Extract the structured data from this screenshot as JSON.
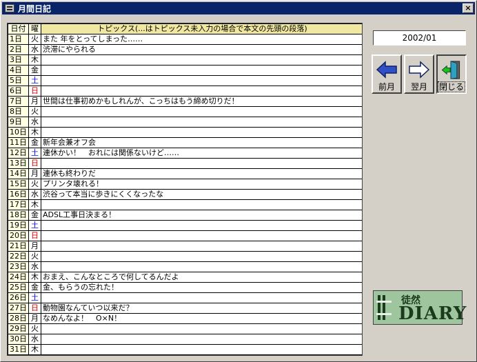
{
  "window": {
    "title": "月間日記",
    "close_glyph": "×"
  },
  "table": {
    "headers": {
      "day": "日付",
      "weekday": "曜",
      "topic": "トピックス(...はトピックス未入力の場合で本文の先頭の段落)"
    },
    "rows": [
      {
        "day": "1日",
        "wd": "火",
        "type": "weekday",
        "topic": "また 年をとってしまった……"
      },
      {
        "day": "2日",
        "wd": "水",
        "type": "weekday",
        "topic": "渋滞にやられる"
      },
      {
        "day": "3日",
        "wd": "木",
        "type": "weekday",
        "topic": ""
      },
      {
        "day": "4日",
        "wd": "金",
        "type": "weekday",
        "topic": ""
      },
      {
        "day": "5日",
        "wd": "土",
        "type": "sat",
        "topic": ""
      },
      {
        "day": "6日",
        "wd": "日",
        "type": "sun",
        "topic": ""
      },
      {
        "day": "7日",
        "wd": "月",
        "type": "weekday",
        "topic": "世間は仕事初めかもしれんが、こっちはもう締め切りだ！"
      },
      {
        "day": "8日",
        "wd": "火",
        "type": "weekday",
        "topic": ""
      },
      {
        "day": "9日",
        "wd": "水",
        "type": "weekday",
        "topic": ""
      },
      {
        "day": "10日",
        "wd": "木",
        "type": "weekday",
        "topic": ""
      },
      {
        "day": "11日",
        "wd": "金",
        "type": "weekday",
        "topic": "新年会兼オフ会"
      },
      {
        "day": "12日",
        "wd": "土",
        "type": "sat",
        "topic": "連休かい！　おれには関係ないけど……"
      },
      {
        "day": "13日",
        "wd": "日",
        "type": "sun",
        "topic": ""
      },
      {
        "day": "14日",
        "wd": "月",
        "type": "weekday",
        "topic": "連休も終わりだ"
      },
      {
        "day": "15日",
        "wd": "火",
        "type": "weekday",
        "topic": "プリンタ壊れる！"
      },
      {
        "day": "16日",
        "wd": "水",
        "type": "weekday",
        "topic": "渋谷って本当に歩きにくくなったな"
      },
      {
        "day": "17日",
        "wd": "木",
        "type": "weekday",
        "topic": ""
      },
      {
        "day": "18日",
        "wd": "金",
        "type": "weekday",
        "topic": "ADSL工事日決まる！"
      },
      {
        "day": "19日",
        "wd": "土",
        "type": "sat",
        "topic": ""
      },
      {
        "day": "20日",
        "wd": "日",
        "type": "sun",
        "topic": ""
      },
      {
        "day": "21日",
        "wd": "月",
        "type": "weekday",
        "topic": ""
      },
      {
        "day": "22日",
        "wd": "火",
        "type": "weekday",
        "topic": ""
      },
      {
        "day": "23日",
        "wd": "水",
        "type": "weekday",
        "topic": ""
      },
      {
        "day": "24日",
        "wd": "木",
        "type": "weekday",
        "topic": "おまえ、こんなところで何してるんだよ"
      },
      {
        "day": "25日",
        "wd": "金",
        "type": "weekday",
        "topic": "金、もらうの忘れた！"
      },
      {
        "day": "26日",
        "wd": "土",
        "type": "sat",
        "topic": ""
      },
      {
        "day": "27日",
        "wd": "日",
        "type": "sun",
        "topic": "動物園なんていつ以来だ？"
      },
      {
        "day": "28日",
        "wd": "月",
        "type": "weekday",
        "topic": "なめんなよ！　O×N！"
      },
      {
        "day": "29日",
        "wd": "火",
        "type": "weekday",
        "topic": ""
      },
      {
        "day": "30日",
        "wd": "水",
        "type": "weekday",
        "topic": ""
      },
      {
        "day": "31日",
        "wd": "木",
        "type": "weekday",
        "topic": ""
      }
    ]
  },
  "month_display": "2002/01",
  "buttons": {
    "prev": "前月",
    "next": "翌月",
    "close": "閉じる"
  },
  "logo": {
    "line1": "徒然",
    "line2": "DIARY"
  },
  "colors": {
    "titlebar": "#0a246a",
    "saturday": "#0000ff",
    "sunday": "#e00000",
    "header_bg": "#ffffe1",
    "face": "#d4d0c8"
  }
}
